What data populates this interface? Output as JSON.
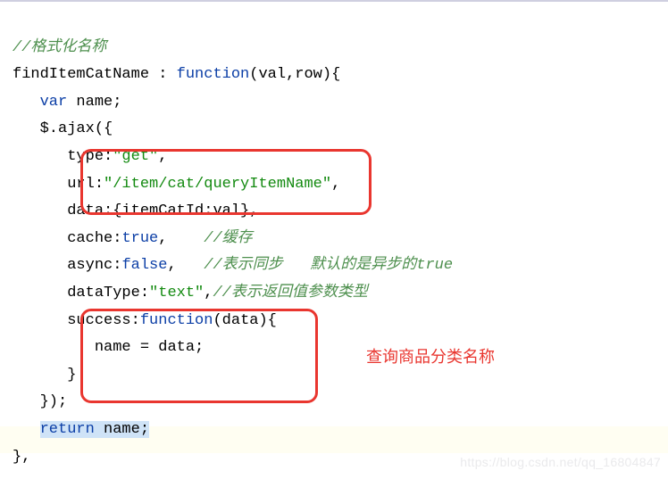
{
  "code": {
    "c_format": "//格式化名称",
    "fn_name": "findItemCatName",
    "colon_fn": " : ",
    "kw_function": "function",
    "fn_params": "(val,row){",
    "kw_var": "var",
    "var_decl": " name;",
    "ajax_open": "$.ajax({",
    "p_type_k": "type",
    "p_type_v": "\"get\"",
    "p_url_k": "url",
    "p_url_v": "\"/item/cat/queryItemName\"",
    "p_data_k": "data",
    "p_data_v": ":{itemCatId:val},",
    "p_cache_k": "cache",
    "p_cache_v": "true",
    "c_cache": "//缓存",
    "p_async_k": "async",
    "p_async_v": "false",
    "c_async": "//表示同步   默认的是异步的true",
    "p_dt_k": "dataType",
    "p_dt_v": "\"text\"",
    "c_dt": "//表示返回值参数类型",
    "p_succ_k": "success",
    "p_succ_fn": "function",
    "p_succ_params": "(data){",
    "succ_body": "name = data;",
    "brace_close": "}",
    "ajax_close": "});",
    "kw_return": "return",
    "ret_expr": " name;",
    "block_close": "},"
  },
  "annotation": "查询商品分类名称",
  "watermark": "https://blog.csdn.net/qq_16804847"
}
